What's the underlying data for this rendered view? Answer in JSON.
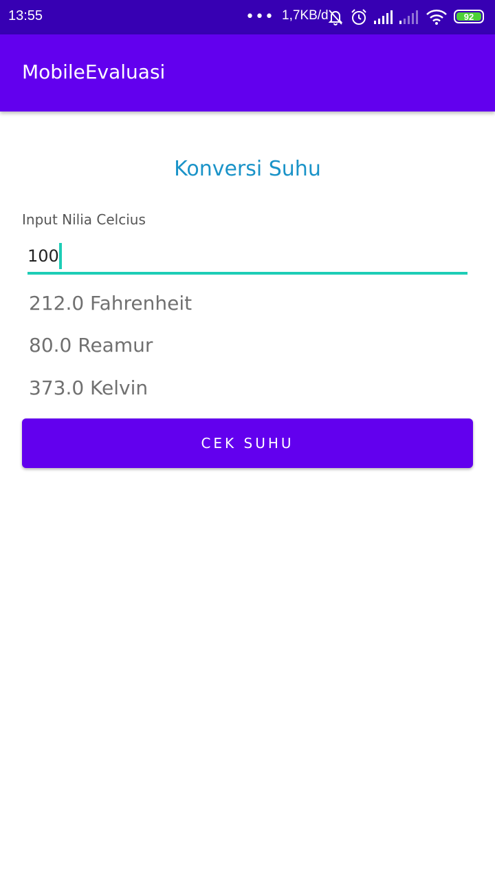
{
  "status_bar": {
    "time": "13:55",
    "more": "•••",
    "network_speed": "1,7KB/d",
    "battery_level": "92",
    "battery_color": "#4CD137",
    "icons": [
      "bell-off-icon",
      "alarm-icon",
      "signal-icon",
      "signal-weak-icon",
      "wifi-icon",
      "battery-icon"
    ]
  },
  "app_bar": {
    "title": "MobileEvaluasi",
    "color": "#6200EE"
  },
  "main": {
    "heading": "Konversi Suhu",
    "input_label": "Input Nilia Celcius",
    "celsius_value": "100",
    "results": {
      "fahrenheit": "212.0 Fahrenheit",
      "reamur": "80.0 Reamur",
      "kelvin": "373.0 Kelvin"
    },
    "button_label": "CEK SUHU"
  },
  "colors": {
    "status_bar": "#3700B3",
    "primary": "#6200EE",
    "heading": "#1A93C8",
    "accent": "#1ECDB6"
  }
}
